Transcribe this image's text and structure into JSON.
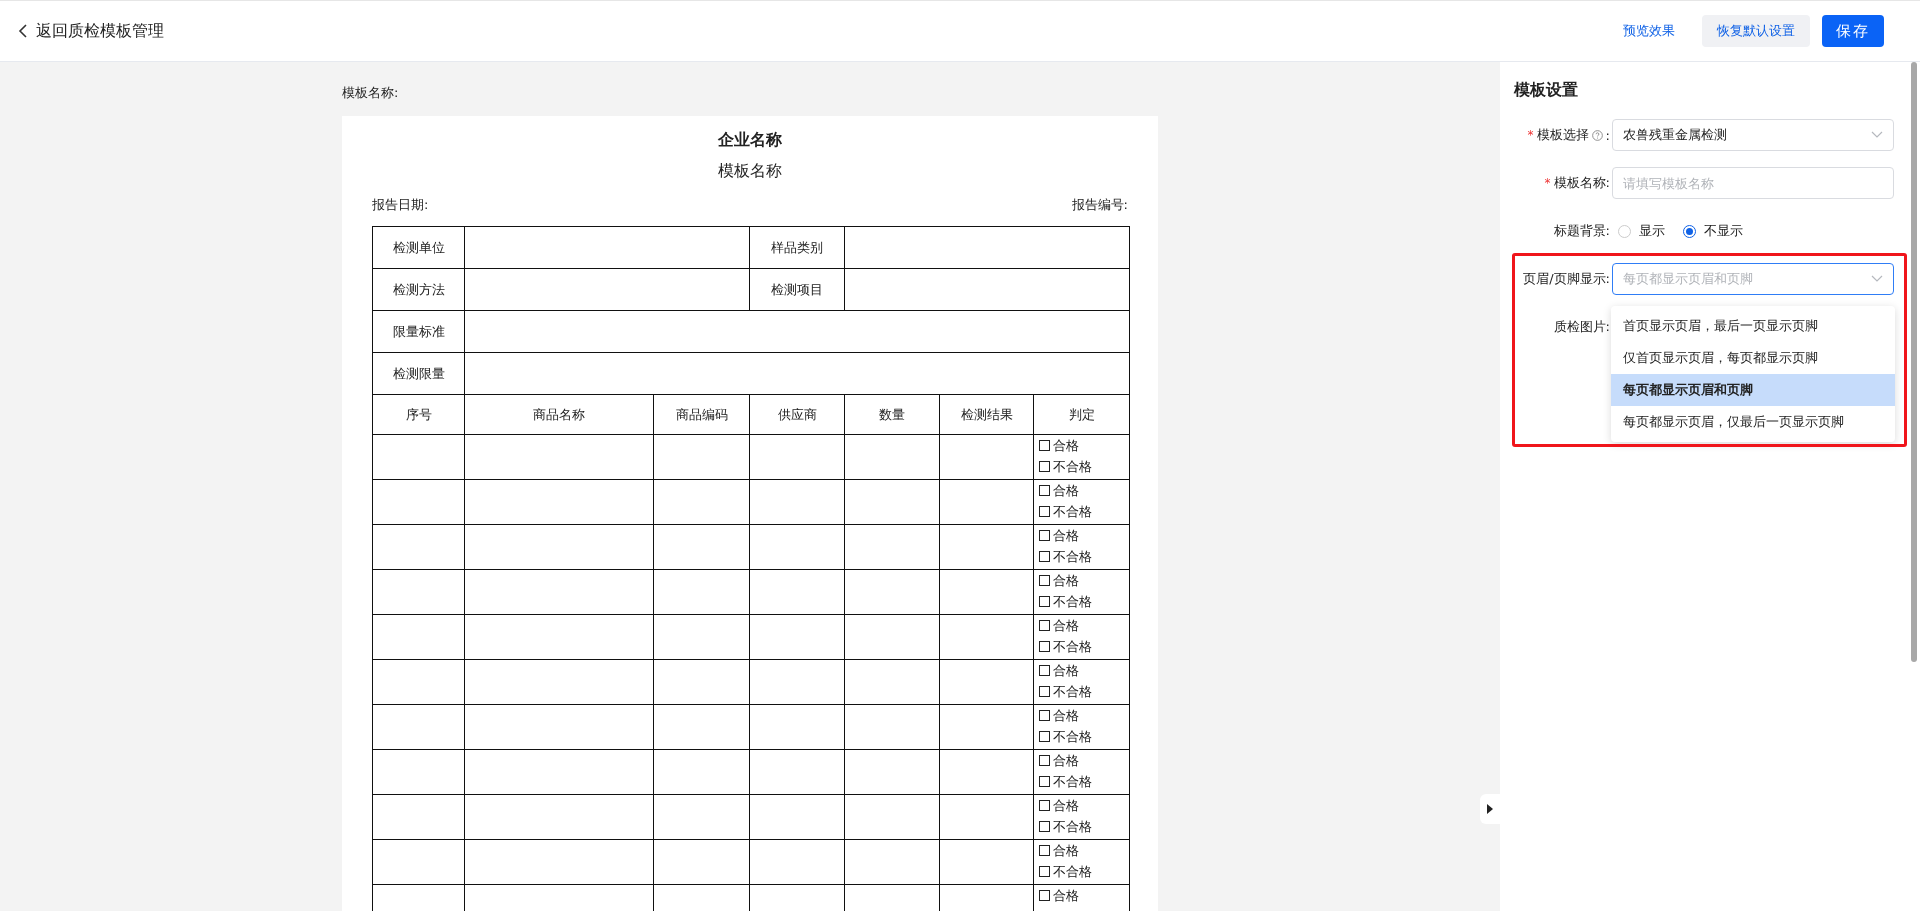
{
  "header": {
    "back_label": "返回质检模板管理",
    "actions": [
      {
        "label": "预览效果",
        "kind": "link"
      },
      {
        "label": "恢复默认设置",
        "kind": "secondary"
      },
      {
        "label": "保存",
        "kind": "primary"
      }
    ]
  },
  "preview": {
    "name_label": "模板名称:",
    "company": "企业名称",
    "template_name": "模板名称",
    "report_date": "报告日期:",
    "report_no": "报告编号:",
    "info_rows": [
      {
        "label": "检测单位",
        "label_2": "样品类别"
      },
      {
        "label": "检测方法",
        "label_2": "检测项目"
      },
      {
        "label": "限量标准"
      },
      {
        "label": "检测限量"
      }
    ],
    "columns": [
      "序号",
      "商品名称",
      "商品编码",
      "供应商",
      "数量",
      "检测结果",
      "判定"
    ],
    "rows": [
      {
        "options": [
          {
            "label": "合格",
            "checked": false
          },
          {
            "label": "不合格",
            "checked": false
          }
        ]
      },
      {
        "options": [
          {
            "label": "合格",
            "checked": false
          },
          {
            "label": "不合格",
            "checked": false
          }
        ]
      },
      {
        "options": [
          {
            "label": "合格",
            "checked": false
          },
          {
            "label": "不合格",
            "checked": false
          }
        ]
      },
      {
        "options": [
          {
            "label": "合格",
            "checked": false
          },
          {
            "label": "不合格",
            "checked": false
          }
        ]
      },
      {
        "options": [
          {
            "label": "合格",
            "checked": false
          },
          {
            "label": "不合格",
            "checked": false
          }
        ]
      },
      {
        "options": [
          {
            "label": "合格",
            "checked": false
          },
          {
            "label": "不合格",
            "checked": false
          }
        ]
      },
      {
        "options": [
          {
            "label": "合格",
            "checked": false
          },
          {
            "label": "不合格",
            "checked": false
          }
        ]
      },
      {
        "options": [
          {
            "label": "合格",
            "checked": false
          },
          {
            "label": "不合格",
            "checked": false
          }
        ]
      },
      {
        "options": [
          {
            "label": "合格",
            "checked": false
          },
          {
            "label": "不合格",
            "checked": false
          }
        ]
      },
      {
        "options": [
          {
            "label": "合格",
            "checked": false
          },
          {
            "label": "不合格",
            "checked": false
          }
        ]
      },
      {
        "options": [
          {
            "label": "合格",
            "checked": false
          }
        ]
      }
    ]
  },
  "settings": {
    "title": "模板设置",
    "template_select": {
      "required_mark": "*",
      "label": "模板选择",
      "label_suffix": ":",
      "value": "农兽残重金属检测"
    },
    "template_name": {
      "required_mark": "*",
      "label": "模板名称:",
      "placeholder": "请填写模板名称"
    },
    "title_background": {
      "label": "标题背景:",
      "options": [
        {
          "label": "显示",
          "selected": false
        },
        {
          "label": "不显示",
          "selected": true
        }
      ]
    },
    "header_footer": {
      "label": "页眉/页脚显示:",
      "placeholder": "每页都显示页眉和页脚",
      "expanded": true,
      "options": [
        {
          "label": "首页显示页眉，最后一页显示页脚",
          "selected": false
        },
        {
          "label": "仅首页显示页眉，每页都显示页脚",
          "selected": false
        },
        {
          "label": "每页都显示页眉和页脚",
          "selected": true
        },
        {
          "label": "每页都显示页眉，仅最后一页显示页脚",
          "selected": false
        }
      ]
    },
    "image_label": "质检图片:"
  }
}
